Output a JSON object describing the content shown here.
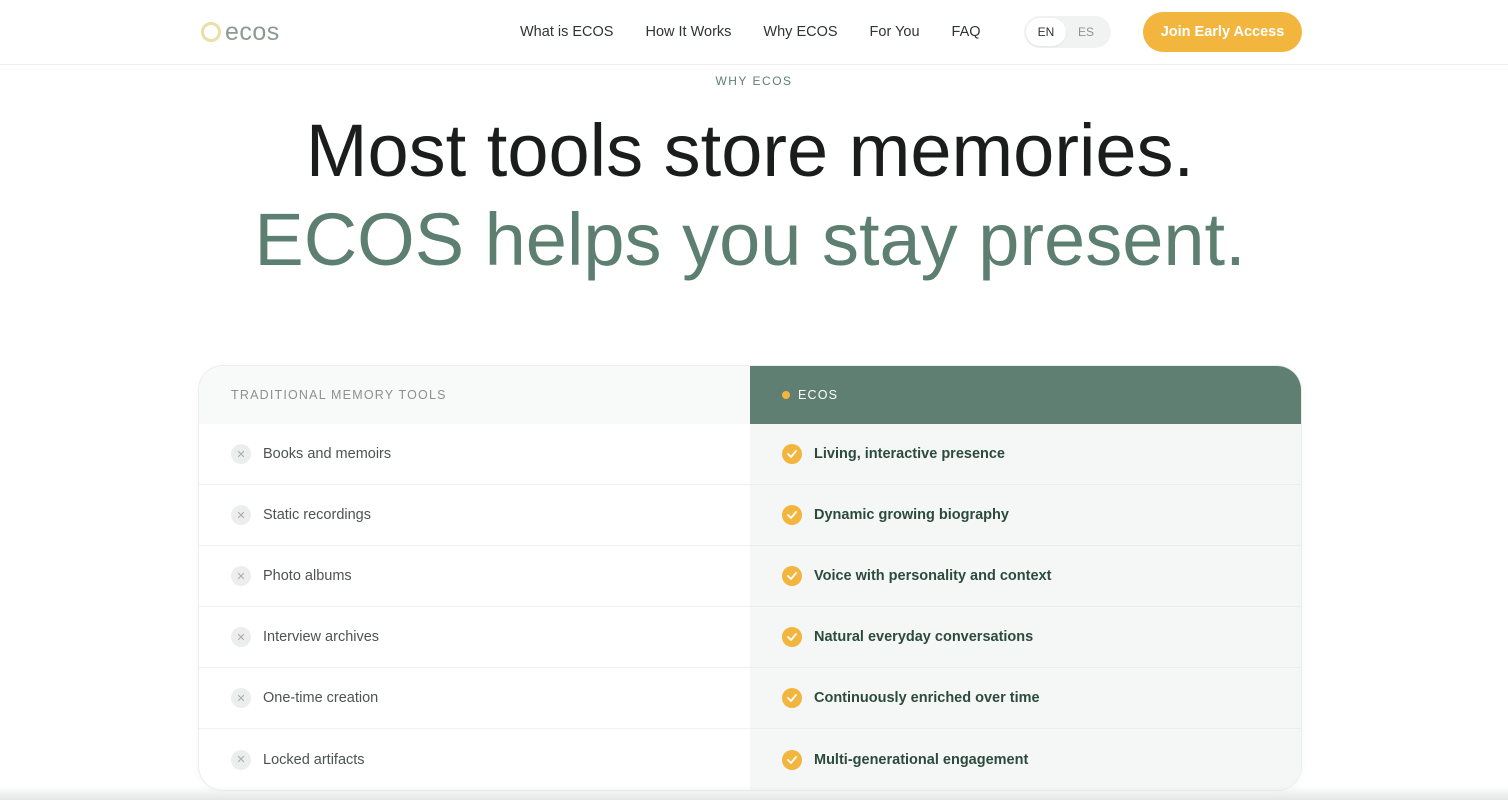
{
  "header": {
    "logo_text": "ecos",
    "nav": [
      "What is ECOS",
      "How It Works",
      "Why ECOS",
      "For You",
      "FAQ"
    ],
    "lang_options": [
      "EN",
      "ES"
    ],
    "lang_selected": "EN",
    "cta_label": "Join Early Access"
  },
  "hero": {
    "eyebrow": "WHY ECOS",
    "headline_line1": "Most tools store memories.",
    "headline_line2": "ECOS helps you stay present."
  },
  "comparison": {
    "left_title": "TRADITIONAL MEMORY TOOLS",
    "right_title": "ECOS",
    "left_items": [
      "Books and memoirs",
      "Static recordings",
      "Photo albums",
      "Interview archives",
      "One-time creation",
      "Locked artifacts"
    ],
    "right_items": [
      "Living, interactive presence",
      "Dynamic growing biography",
      "Voice with personality and context",
      "Natural everyday conversations",
      "Continuously enriched over time",
      "Multi-generational engagement"
    ]
  },
  "colors": {
    "accent": "#f2b53e",
    "brand_green": "#5f7f72",
    "text_dark": "#1b1d1c"
  },
  "icons": {
    "negative": "close-icon",
    "positive": "check-icon"
  }
}
